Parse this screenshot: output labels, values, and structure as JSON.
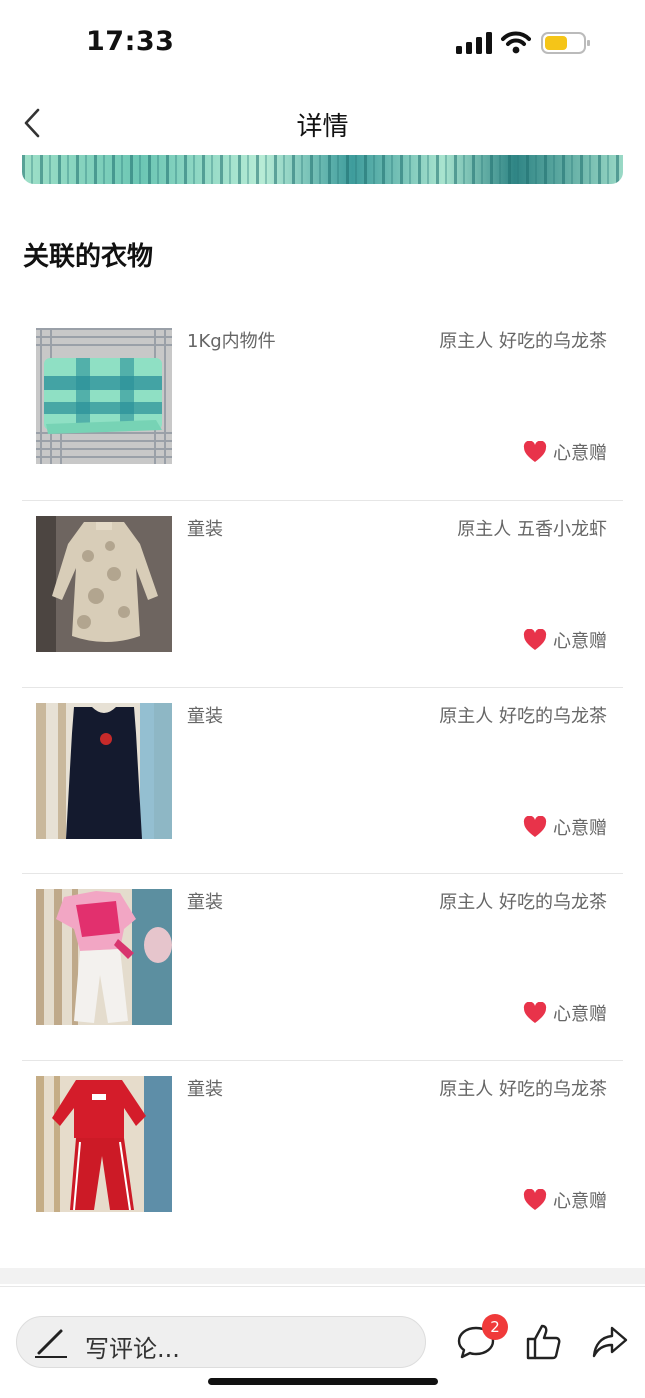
{
  "status_bar": {
    "time": "17:33",
    "battery_color": "#f5c518"
  },
  "nav": {
    "title": "详情"
  },
  "section": {
    "title": "关联的衣物"
  },
  "items": [
    {
      "category": "1Kg内物件",
      "owner": "原主人 好吃的乌龙茶",
      "tag": "心意赠",
      "thumb": "green-plaid-garments"
    },
    {
      "category": "童装",
      "owner": "原主人 五香小龙虾",
      "tag": "心意赠",
      "thumb": "floral-dress"
    },
    {
      "category": "童装",
      "owner": "原主人 好吃的乌龙茶",
      "tag": "心意赠",
      "thumb": "navy-dress"
    },
    {
      "category": "童装",
      "owner": "原主人 好吃的乌龙茶",
      "tag": "心意赠",
      "thumb": "pink-outfit"
    },
    {
      "category": "童装",
      "owner": "原主人 好吃的乌龙茶",
      "tag": "心意赠",
      "thumb": "red-tracksuit"
    }
  ],
  "bottom_bar": {
    "comment_placeholder": "写评论...",
    "comment_count": "2",
    "icons": [
      "pen-icon",
      "comment-icon",
      "thumbs-up-icon",
      "share-icon"
    ]
  },
  "colors": {
    "heart": "#e8334a",
    "badge": "#f03a3a",
    "text_muted": "#666666"
  }
}
